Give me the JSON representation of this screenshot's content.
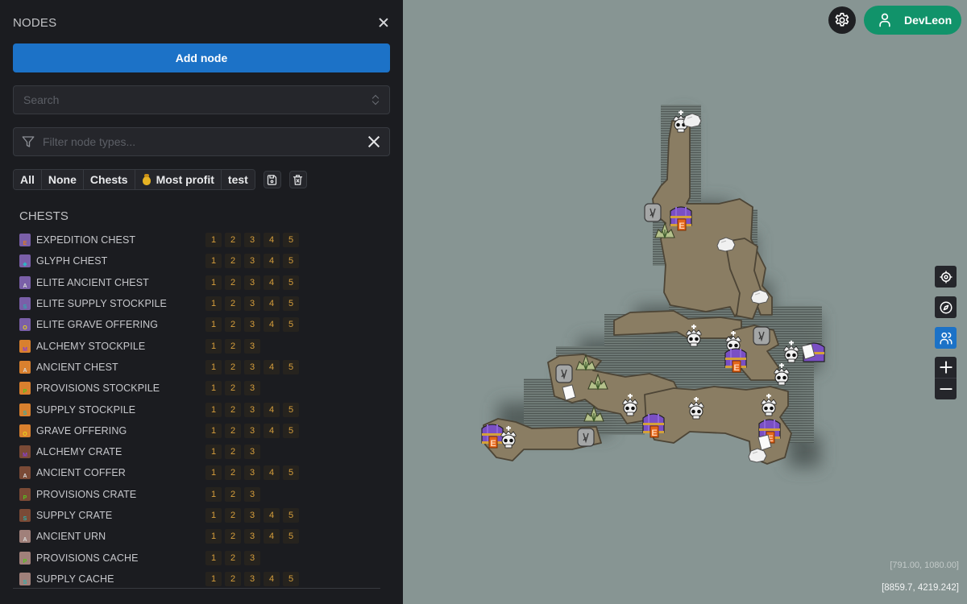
{
  "sidebar": {
    "title": "NODES",
    "add_node_label": "Add node",
    "search": {
      "placeholder": "Search",
      "value": ""
    },
    "filter": {
      "placeholder": "Filter node types...",
      "value": ""
    },
    "presets": [
      {
        "label": "All"
      },
      {
        "label": "None"
      },
      {
        "label": "Chests"
      },
      {
        "label": "Most profit",
        "icon": "moneybag-icon"
      },
      {
        "label": "test"
      }
    ],
    "preset_actions": [
      {
        "name": "save-preset-button",
        "icon": "floppy-disk-icon"
      },
      {
        "name": "delete-preset-button",
        "icon": "trash-x-icon"
      }
    ],
    "section_title": "CHESTS",
    "nodes": [
      {
        "label": "EXPEDITION CHEST",
        "icon": "expedition-chest-icon",
        "tiers": [
          "1",
          "2",
          "3",
          "4",
          "5"
        ],
        "body": "#7a5fa8",
        "badge": "E",
        "badge_color": "#e07a1f"
      },
      {
        "label": "GLYPH CHEST",
        "icon": "glyph-chest-icon",
        "tiers": [
          "1",
          "2",
          "3",
          "4",
          "5"
        ],
        "body": "#7a5fa8",
        "badge": "◆",
        "badge_color": "#2fb5c4"
      },
      {
        "label": "ELITE ANCIENT CHEST",
        "icon": "elite-ancient-chest-icon",
        "tiers": [
          "1",
          "2",
          "3",
          "4",
          "5"
        ],
        "body": "#7a5fa8",
        "badge": "A",
        "badge_color": "#d9d9d9"
      },
      {
        "label": "ELITE SUPPLY STOCKPILE",
        "icon": "elite-supply-stockpile-icon",
        "tiers": [
          "1",
          "2",
          "3",
          "4",
          "5"
        ],
        "body": "#7a5fa8",
        "badge": "S",
        "badge_color": "#28b3b0"
      },
      {
        "label": "ELITE GRAVE OFFERING",
        "icon": "elite-grave-offering-icon",
        "tiers": [
          "1",
          "2",
          "3",
          "4",
          "5"
        ],
        "body": "#7a5fa8",
        "badge": "O",
        "badge_color": "#e8d21c"
      },
      {
        "label": "ALCHEMY STOCKPILE",
        "icon": "alchemy-stockpile-icon",
        "tiers": [
          "1",
          "2",
          "3"
        ],
        "body": "#d9802e",
        "badge": "M",
        "badge_color": "#8a3fd1"
      },
      {
        "label": "ANCIENT CHEST",
        "icon": "ancient-chest-icon",
        "tiers": [
          "1",
          "2",
          "3",
          "4",
          "5"
        ],
        "body": "#d9802e",
        "badge": "A",
        "badge_color": "#d9d9d9"
      },
      {
        "label": "PROVISIONS STOCKPILE",
        "icon": "provisions-stockpile-icon",
        "tiers": [
          "1",
          "2",
          "3"
        ],
        "body": "#d9802e",
        "badge": "P",
        "badge_color": "#56c41d"
      },
      {
        "label": "SUPPLY STOCKPILE",
        "icon": "supply-stockpile-icon",
        "tiers": [
          "1",
          "2",
          "3",
          "4",
          "5"
        ],
        "body": "#d9802e",
        "badge": "S",
        "badge_color": "#28b3b0"
      },
      {
        "label": "GRAVE OFFERING",
        "icon": "grave-offering-icon",
        "tiers": [
          "1",
          "2",
          "3",
          "4",
          "5"
        ],
        "body": "#d9802e",
        "badge": "O",
        "badge_color": "#e8d21c"
      },
      {
        "label": "ALCHEMY CRATE",
        "icon": "alchemy-crate-icon",
        "tiers": [
          "1",
          "2",
          "3"
        ],
        "body": "#7a4a36",
        "badge": "M",
        "badge_color": "#8a3fd1"
      },
      {
        "label": "ANCIENT COFFER",
        "icon": "ancient-coffer-icon",
        "tiers": [
          "1",
          "2",
          "3",
          "4",
          "5"
        ],
        "body": "#7a4a36",
        "badge": "A",
        "badge_color": "#d9d9d9"
      },
      {
        "label": "PROVISIONS CRATE",
        "icon": "provisions-crate-icon",
        "tiers": [
          "1",
          "2",
          "3"
        ],
        "body": "#7a4a36",
        "badge": "P",
        "badge_color": "#56c41d"
      },
      {
        "label": "SUPPLY CRATE",
        "icon": "supply-crate-icon",
        "tiers": [
          "1",
          "2",
          "3",
          "4",
          "5"
        ],
        "body": "#7a4a36",
        "badge": "S",
        "badge_color": "#28b3b0"
      },
      {
        "label": "ANCIENT URN",
        "icon": "ancient-urn-icon",
        "tiers": [
          "1",
          "2",
          "3",
          "4",
          "5"
        ],
        "body": "#a0807a",
        "badge": "A",
        "badge_color": "#d9d9d9"
      },
      {
        "label": "PROVISIONS CACHE",
        "icon": "provisions-cache-icon",
        "tiers": [
          "1",
          "2",
          "3"
        ],
        "body": "#a0807a",
        "badge": "P",
        "badge_color": "#56c41d"
      },
      {
        "label": "SUPPLY CACHE",
        "icon": "supply-cache-icon",
        "tiers": [
          "1",
          "2",
          "3",
          "4",
          "5"
        ],
        "body": "#a0807a",
        "badge": "S",
        "badge_color": "#28b3b0"
      }
    ]
  },
  "header": {
    "username": "DevLeon"
  },
  "map_controls": [
    {
      "name": "locate-button",
      "icon": "crosshair-icon"
    },
    {
      "name": "compass-button",
      "icon": "compass-icon"
    },
    {
      "name": "players-button",
      "icon": "users-icon",
      "active": true
    }
  ],
  "map": {
    "cursor_coords": "[791.00, 1080.00]",
    "world_coords": "[8859.7, 4219.242]",
    "markers": [
      {
        "type": "boss-skull",
        "icon": "crowned-skull-icon"
      },
      {
        "type": "ore",
        "icon": "ore-rock-icon"
      },
      {
        "type": "rune-stone",
        "icon": "rune-stone-icon"
      },
      {
        "type": "expedition-chest",
        "icon": "expedition-chest-icon"
      },
      {
        "type": "herb",
        "icon": "herb-plant-icon"
      },
      {
        "type": "ore",
        "icon": "ore-rock-icon"
      },
      {
        "type": "ore",
        "icon": "ore-rock-icon"
      },
      {
        "type": "boss-skull",
        "icon": "crowned-skull-icon"
      },
      {
        "type": "boss-skull",
        "icon": "crowned-skull-icon"
      },
      {
        "type": "expedition-chest",
        "icon": "expedition-chest-icon"
      },
      {
        "type": "rune-stone",
        "icon": "rune-stone-icon"
      },
      {
        "type": "boss-skull",
        "icon": "crowned-skull-icon"
      },
      {
        "type": "glyph-chest",
        "icon": "glyph-chest-icon"
      },
      {
        "type": "note",
        "icon": "note-icon"
      },
      {
        "type": "boss-skull",
        "icon": "crowned-skull-icon"
      },
      {
        "type": "rune-stone",
        "icon": "rune-stone-icon"
      },
      {
        "type": "herb",
        "icon": "herb-plant-icon"
      },
      {
        "type": "herb",
        "icon": "herb-plant-icon"
      },
      {
        "type": "note",
        "icon": "note-icon"
      },
      {
        "type": "herb",
        "icon": "herb-plant-icon"
      },
      {
        "type": "rune-stone",
        "icon": "rune-stone-icon"
      },
      {
        "type": "boss-skull",
        "icon": "crowned-skull-icon"
      },
      {
        "type": "expedition-chest",
        "icon": "expedition-chest-icon"
      },
      {
        "type": "boss-skull",
        "icon": "crowned-skull-icon"
      },
      {
        "type": "boss-skull",
        "icon": "crowned-skull-icon"
      },
      {
        "type": "expedition-chest",
        "icon": "expedition-chest-icon"
      },
      {
        "type": "note",
        "icon": "note-icon"
      },
      {
        "type": "ore",
        "icon": "ore-rock-icon"
      },
      {
        "type": "expedition-chest",
        "icon": "expedition-chest-icon"
      },
      {
        "type": "boss-skull",
        "icon": "crowned-skull-icon"
      }
    ]
  }
}
